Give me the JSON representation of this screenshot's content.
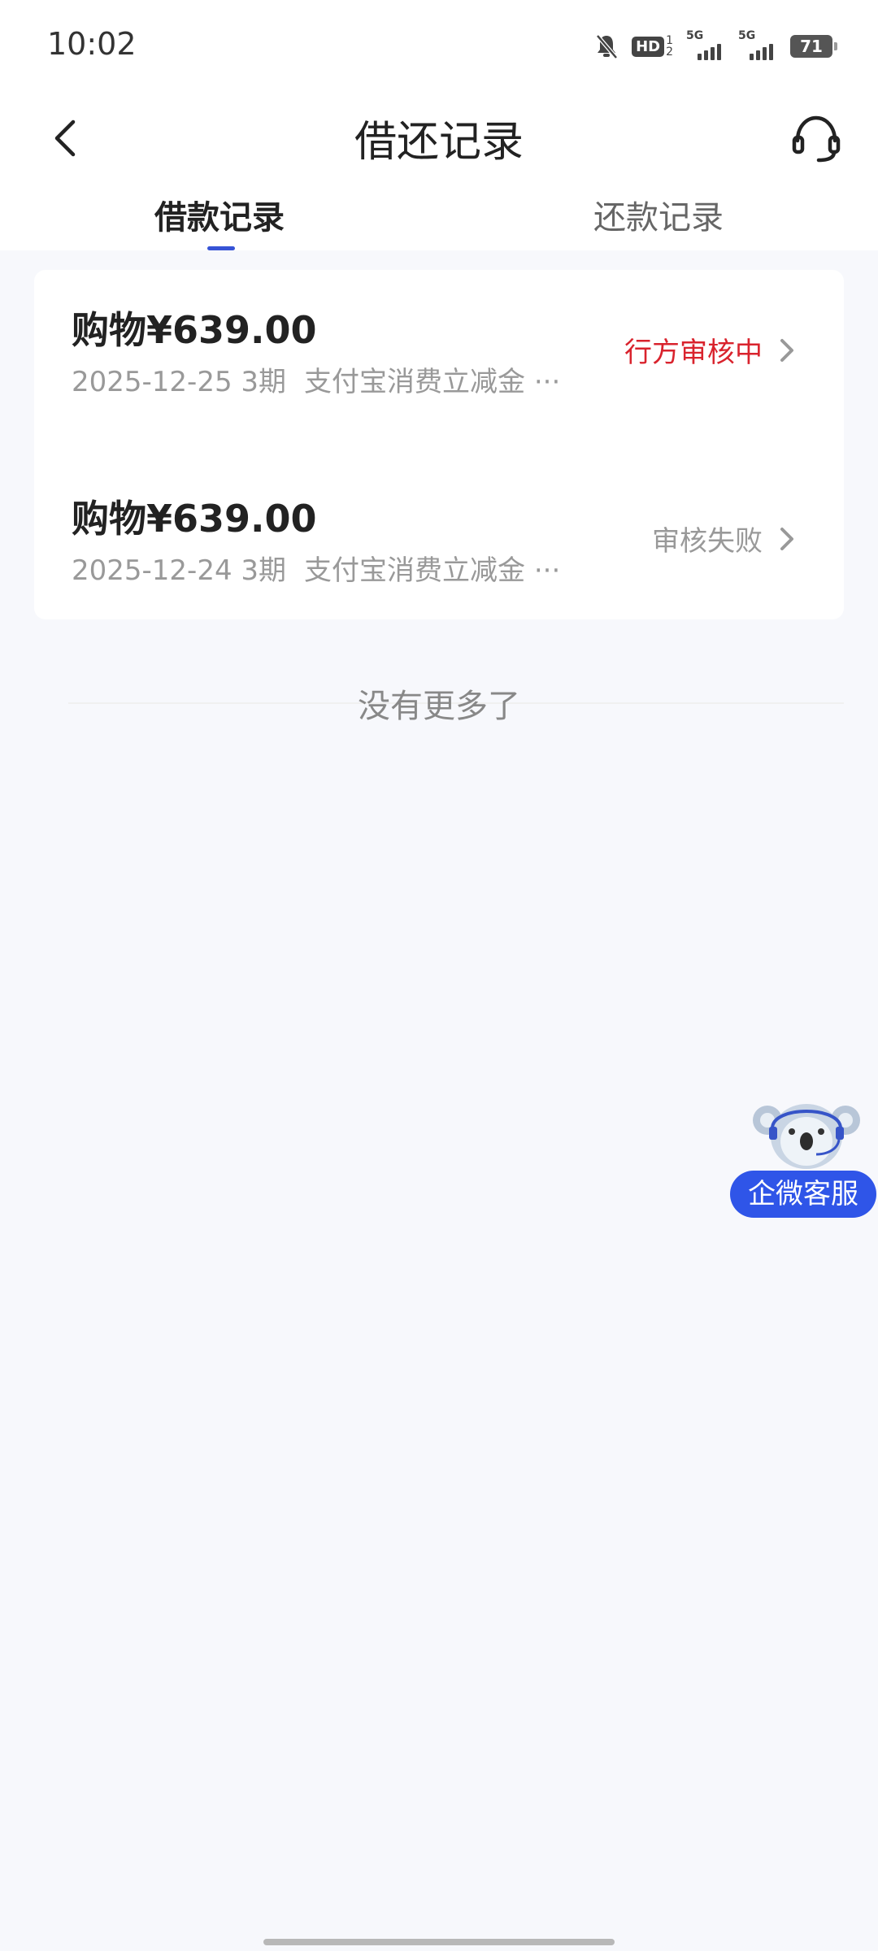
{
  "status_bar": {
    "time": "10:02",
    "hd_label": "HD",
    "hd_sub": "1\n2",
    "signal1_label": "5G",
    "signal2_label": "5G",
    "battery": "71",
    "icons": [
      "mute-bell-icon",
      "hd-voice-icon",
      "signal-5g-icon",
      "signal-5g-icon",
      "battery-icon"
    ]
  },
  "header": {
    "title": "借还记录",
    "back_icon": "chevron-left-icon",
    "service_icon": "headset-icon"
  },
  "tabs": [
    {
      "label": "借款记录",
      "active": true
    },
    {
      "label": "还款记录",
      "active": false
    }
  ],
  "records": [
    {
      "amount": "购物¥639.00",
      "date_term": "2025-12-25 3期",
      "desc": "支付宝消费立减金 ···",
      "status": "行方审核中",
      "status_color": "#d9232d"
    },
    {
      "amount": "购物¥639.00",
      "date_term": "2025-12-24 3期",
      "desc": "支付宝消费立减金 ···",
      "status": "审核失败",
      "status_color": "#999999"
    }
  ],
  "footer_note": "没有更多了",
  "float_service": {
    "label": "企微客服",
    "mascot": "koala-mascot-icon",
    "color": "#2f55e8"
  },
  "colors": {
    "accent": "#3653d6",
    "background": "#f7f8fc"
  }
}
